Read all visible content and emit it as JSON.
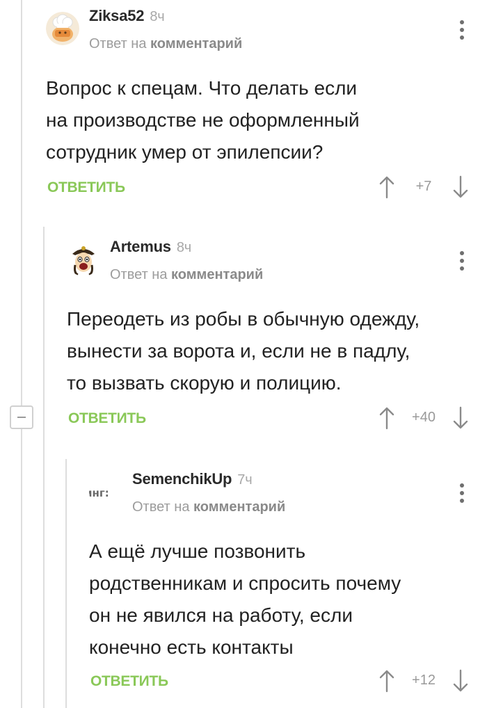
{
  "reply_prefix": "Ответ на",
  "reply_target": "комментарий",
  "reply_button_label": "ОТВЕТИТЬ",
  "colors": {
    "reply_button": "#8ac858",
    "thread_line": "#dddddd",
    "meta_text": "#9c9c9c"
  },
  "comments": [
    {
      "author": "Ziksa52",
      "time": "8ч",
      "avatar_icon": "chef-hat-cartoon-avatar",
      "text_lines": [
        "Вопрос к спецам. Что делать если",
        "на производстве не оформленный",
        "сотрудник умер от эпилепсии?"
      ],
      "rating": "+7"
    },
    {
      "author": "Artemus",
      "time": "8ч",
      "avatar_icon": "pirate-cartoon-avatar",
      "text_lines": [
        "Переодеть из робы в обычную одежду,",
        "вынести за ворота и, если не в падлу,",
        "то вызвать скорую и полицию."
      ],
      "rating": "+40"
    },
    {
      "author": "SemenchikUp",
      "time": "7ч",
      "avatar_icon": "text-fragment-avatar",
      "avatar_text": "инг:",
      "text_lines": [
        "А ещё лучше позвонить",
        "родственникам и спросить почему",
        "он не явился на работу, если",
        "конечно есть контакты"
      ],
      "rating": "+12"
    }
  ]
}
